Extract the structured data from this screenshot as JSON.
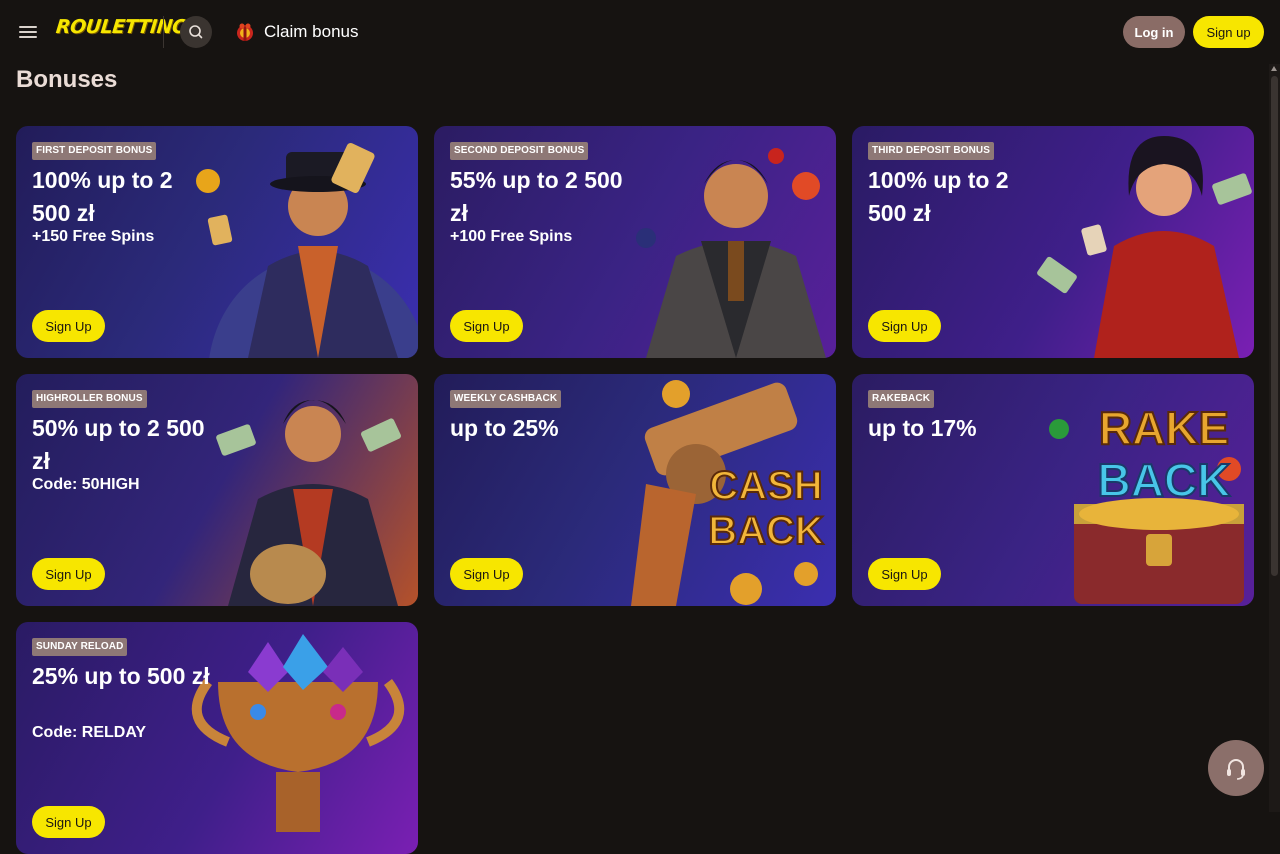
{
  "header": {
    "logo": "ROULETTINO",
    "claim_label": "Claim bonus",
    "login_label": "Log in",
    "signup_label": "Sign up"
  },
  "page": {
    "title": "Bonuses"
  },
  "cards": [
    {
      "tag": "FIRST DEPOSIT BONUS",
      "headline": "100% up to 2 500 zł",
      "sub": "+150 Free Spins",
      "cta": "Sign Up"
    },
    {
      "tag": "SECOND DEPOSIT BONUS",
      "headline": "55% up to 2 500 zł",
      "sub": "+100 Free Spins",
      "cta": "Sign Up"
    },
    {
      "tag": "THIRD DEPOSIT BONUS",
      "headline": "100% up to 2 500 zł",
      "sub": "",
      "cta": "Sign Up"
    },
    {
      "tag": "HIGHROLLER BONUS",
      "headline": "50% up to 2 500 zł",
      "sub": "Code: 50HIGH",
      "cta": "Sign Up"
    },
    {
      "tag": "WEEKLY CASHBACK",
      "headline": "up to 25%",
      "sub": "",
      "cta": "Sign Up",
      "art_text": [
        "CASH",
        "BACK"
      ]
    },
    {
      "tag": "RAKEBACK",
      "headline": "up to 17%",
      "sub": "",
      "cta": "Sign Up",
      "art_text": [
        "RAKE",
        "BACK"
      ]
    },
    {
      "tag": "SUNDAY RELOAD",
      "headline": "25% up to 500 zł",
      "sub": "Code: RELDAY",
      "cta": "Sign Up"
    }
  ],
  "icons": {
    "menu": "hamburger-icon",
    "search": "search-icon",
    "claim": "gift-icon",
    "support": "headset-icon"
  },
  "colors": {
    "accent": "#f7e600",
    "login_bg": "#8a6c66",
    "tag_bg": "#8e7876",
    "page_bg": "#161311"
  }
}
